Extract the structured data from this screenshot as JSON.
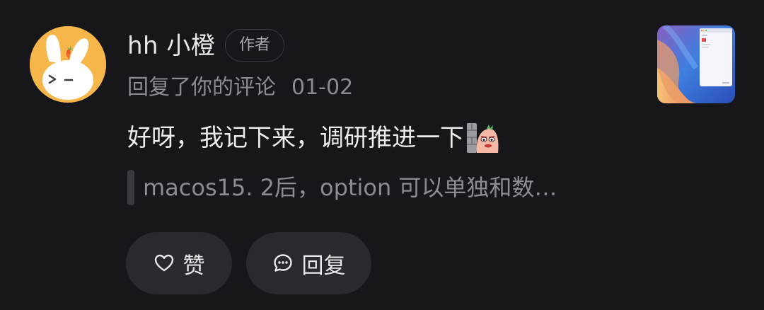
{
  "comment": {
    "user_name": "hh 小橙",
    "author_badge": "作者",
    "action_text": "回复了你的评论",
    "date": "01-02",
    "text": "好呀，我记下来，调研推进一下",
    "sticker_icon": "peeking-carrot-sticker-icon",
    "quoted_text": "macos15. 2后，option 可以单独和数…"
  },
  "actions": {
    "like_label": "赞",
    "reply_label": "回复"
  },
  "colors": {
    "background": "#17161b",
    "avatar_bg": "#f6b64a",
    "button_bg": "#2a292f",
    "primary_text": "#ececef",
    "secondary_text": "#8c8b92"
  }
}
